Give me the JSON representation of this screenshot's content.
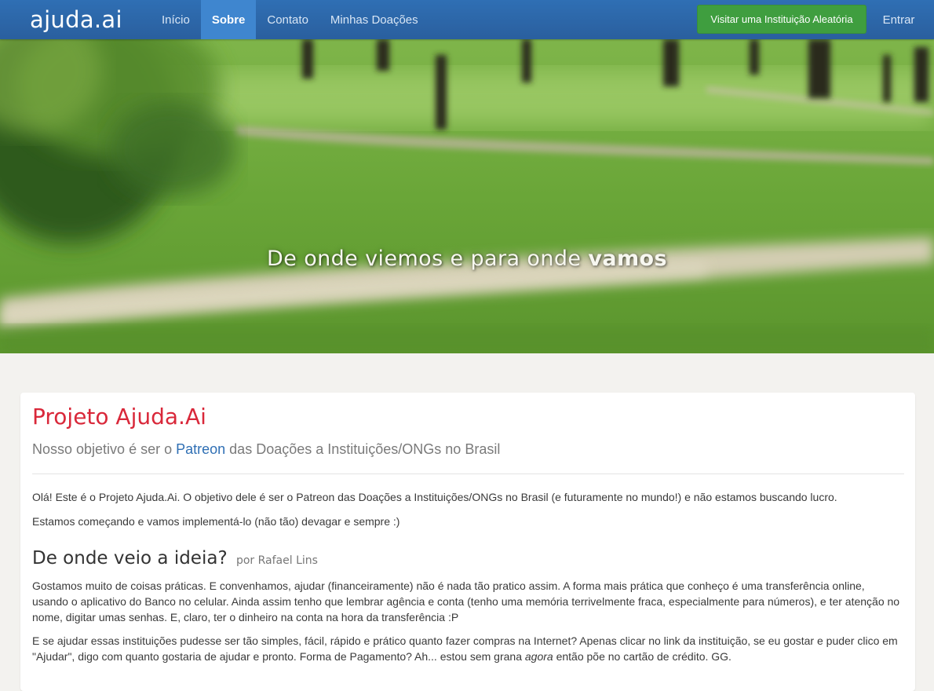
{
  "navbar": {
    "brand": "ajuda.ai",
    "links": [
      {
        "label": "Início"
      },
      {
        "label": "Sobre"
      },
      {
        "label": "Contato"
      },
      {
        "label": "Minhas Doações"
      }
    ],
    "cta_label": "Visitar uma Instituição Aleatória",
    "login_label": "Entrar"
  },
  "hero": {
    "title_prefix": "De onde viemos e para onde",
    "title_bold": "vamos"
  },
  "content": {
    "title": "Projeto Ajuda.Ai",
    "subtitle_prefix": "Nosso objetivo é ser o",
    "subtitle_link": "Patreon",
    "subtitle_suffix": "das Doações a Instituições/ONGs no Brasil",
    "paragraphs": [
      "Olá! Este é o Projeto Ajuda.Ai. O objetivo dele é ser o Patreon das Doações a Instituições/ONGs no Brasil (e futuramente no mundo!) e não estamos buscando lucro.",
      "Estamos começando e vamos implementá-lo (não tão) devagar e sempre :)"
    ],
    "section": {
      "heading": "De onde veio a ideia?",
      "byline": "por Rafael Lins",
      "paragraph1": "Gostamos muito de coisas práticas. E convenhamos, ajudar (financeiramente) não é nada tão pratico assim. A forma mais prática que conheço é uma transferência online, usando o aplicativo do Banco no celular. Ainda assim tenho que lembrar agência e conta (tenho uma memória terrivelmente fraca, especialmente para números), e ter atenção no nome, digitar umas senhas. E, claro, ter o dinheiro na conta na hora da transferência :P",
      "paragraph2_before": "E se ajudar essas instituições pudesse ser tão simples, fácil, rápido e prático quanto fazer compras na Internet? Apenas clicar no link da instituição, se eu gostar e puder clico em \"Ajudar\", digo com quanto gostaria de ajudar e pronto. Forma de Pagamento? Ah... estou sem grana",
      "paragraph2_em": "agora",
      "paragraph2_after": "então põe no cartão de crédito. GG."
    }
  }
}
